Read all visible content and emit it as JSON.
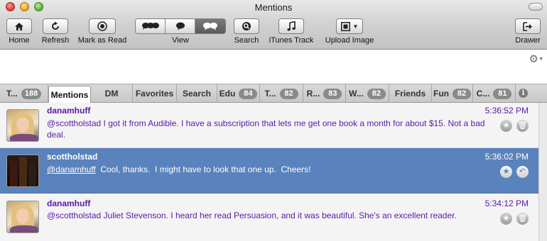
{
  "window": {
    "title": "Mentions"
  },
  "toolbar": {
    "home": {
      "label": "Home",
      "icon": "home-icon"
    },
    "refresh": {
      "label": "Refresh",
      "icon": "refresh-icon"
    },
    "mark_as_read": {
      "label": "Mark as Read",
      "icon": "radio-dot-icon"
    },
    "view": {
      "label": "View",
      "segments": [
        "multi-bubble-icon",
        "single-bubble-icon",
        "conversation-icon"
      ],
      "active_index": 2
    },
    "search": {
      "label": "Search",
      "icon": "magnifier-icon"
    },
    "itunes_track": {
      "label": "iTunes Track",
      "icon": "music-note-icon"
    },
    "upload_image": {
      "label": "Upload Image",
      "icon": "image-icon"
    },
    "drawer": {
      "label": "Drawer",
      "icon": "drawer-icon"
    }
  },
  "tabs": [
    {
      "label": "T...",
      "badge": "188"
    },
    {
      "label": "Mentions",
      "badge": null,
      "selected": true
    },
    {
      "label": "DM",
      "badge": null
    },
    {
      "label": "Favorites",
      "badge": null
    },
    {
      "label": "Search",
      "badge": null
    },
    {
      "label": "Edu",
      "badge": "84"
    },
    {
      "label": "T...",
      "badge": "82"
    },
    {
      "label": "R...",
      "badge": "83"
    },
    {
      "label": "W...",
      "badge": "82"
    },
    {
      "label": "Friends",
      "badge": null
    },
    {
      "label": "Fun",
      "badge": "82"
    },
    {
      "label": "C...",
      "badge": "81"
    }
  ],
  "info_icon": "i",
  "tweets": [
    {
      "author": "danamhuff",
      "time": "5:36:52 PM",
      "text": "@scottholstad I got it from Audible. I have a subscription that lets me get one book a month for about $15. Not a bad deal.",
      "selected": false
    },
    {
      "author": "scottholstad",
      "time": "5:36:02 PM",
      "mention": "@danamhuff",
      "text": "  Cool, thanks.  I might have to look that one up.  Cheers!",
      "selected": true
    },
    {
      "author": "danamhuff",
      "time": "5:34:12 PM",
      "text": "@scottholstad Juliet Stevenson. I heard her read Persuasion, and it was beautiful. She's an excellent reader.",
      "selected": false
    }
  ],
  "colors": {
    "link_purple": "#5a1aa8",
    "selection_blue": "#5a82bc",
    "badge_gray": "#8a8a8a"
  }
}
